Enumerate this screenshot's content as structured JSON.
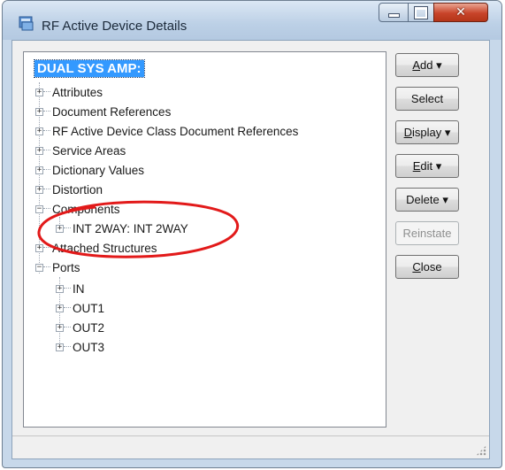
{
  "window": {
    "title": "RF Active Device Details",
    "controls": {
      "minimize": "minimize-icon",
      "maximize": "maximize-icon",
      "close": "close-icon"
    }
  },
  "tree": {
    "root": "DUAL SYS AMP:",
    "items": [
      {
        "label": "Attributes",
        "expander": "+"
      },
      {
        "label": "Document References",
        "expander": "+"
      },
      {
        "label": "RF Active Device Class Document References",
        "expander": "+"
      },
      {
        "label": "Service Areas",
        "expander": "+"
      },
      {
        "label": "Dictionary Values",
        "expander": "+"
      },
      {
        "label": "Distortion",
        "expander": "+"
      },
      {
        "label": "Components",
        "expander": "−"
      },
      {
        "label": "INT 2WAY: INT 2WAY",
        "expander": "+"
      },
      {
        "label": "Attached Structures",
        "expander": "+"
      },
      {
        "label": "Ports",
        "expander": "−"
      },
      {
        "label": "IN",
        "expander": "+"
      },
      {
        "label": "OUT1",
        "expander": "+"
      },
      {
        "label": "OUT2",
        "expander": "+"
      },
      {
        "label": "OUT3",
        "expander": "+"
      }
    ]
  },
  "buttons": {
    "add": {
      "label": "Add",
      "mnemonic": "A",
      "rest": "dd",
      "arrow": "▾"
    },
    "select": {
      "label": "Select"
    },
    "display": {
      "label": "Display",
      "mnemonic": "D",
      "rest": "isplay",
      "arrow": "▾"
    },
    "edit": {
      "label": "Edit",
      "mnemonic": "E",
      "rest": "dit",
      "arrow": "▾"
    },
    "delete": {
      "label": "Delete",
      "arrow": "▾"
    },
    "reinstate": {
      "label": "Reinstate",
      "enabled": false
    },
    "close": {
      "label": "Close",
      "mnemonic": "C",
      "rest": "lose"
    }
  },
  "colors": {
    "selection": "#3399ff",
    "annotation": "#e21a1a",
    "close_button": "#c8442a"
  }
}
